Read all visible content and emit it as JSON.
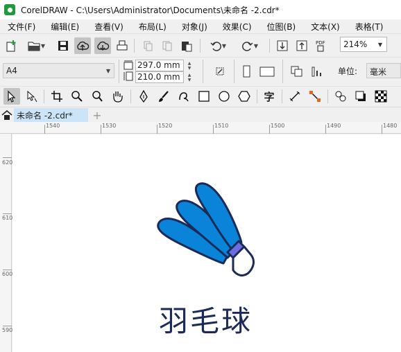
{
  "window": {
    "title": "CorelDRAW - C:\\Users\\Administrator\\Documents\\未命名 -2.cdr*"
  },
  "menu": [
    "文件(F)",
    "编辑(E)",
    "查看(V)",
    "布局(L)",
    "对象(J)",
    "效果(C)",
    "位图(B)",
    "文本(X)",
    "表格(T)"
  ],
  "toolbar": {
    "zoom": "214%",
    "pdf_label": "PDF"
  },
  "property_bar": {
    "page_size": "A4",
    "width": "297.0 mm",
    "height": "210.0 mm",
    "unit_label": "单位:",
    "unit": "毫米"
  },
  "tools": {
    "text_tool_glyph": "字"
  },
  "tabs": {
    "document": "未命名 -2.cdr*"
  },
  "ruler_h": [
    "1540",
    "1530",
    "1520",
    "1510",
    "1500",
    "1490",
    "1480"
  ],
  "ruler_v": [
    "620",
    "610",
    "600",
    "590"
  ],
  "artwork": {
    "caption": "羽毛球",
    "colors": {
      "feather": "#0a84d8",
      "outline": "#1b2a56",
      "band": "#6a6ee0",
      "cork": "#ffffff"
    }
  },
  "colors": {
    "active_tab": "#cce4f7",
    "app_logo": "#1e9a3c"
  }
}
